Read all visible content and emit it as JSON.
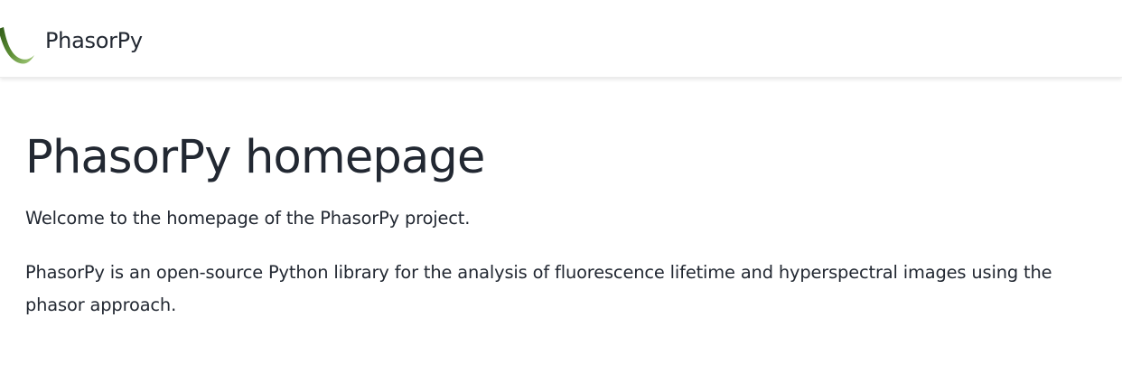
{
  "navbar": {
    "logo_icon": "phasorpy-logo-icon",
    "brand_label": "PhasorPy",
    "accent_colors": [
      "#3d6b1f",
      "#8fbf5f"
    ]
  },
  "main": {
    "title": "PhasorPy homepage",
    "paragraphs": [
      "Welcome to the homepage of the PhasorPy project.",
      "PhasorPy is an open-source Python library for the analysis of fluorescence lifetime and hyperspectral images using the phasor approach."
    ]
  }
}
